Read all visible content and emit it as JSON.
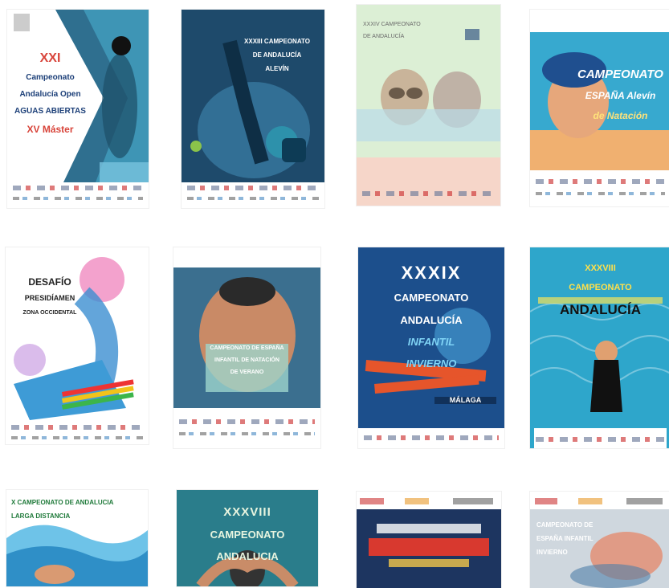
{
  "posters": [
    {
      "id": 1,
      "lines": [
        "XXI",
        "Campeonato",
        "Andalucía Open",
        "AGUAS ABIERTAS",
        "XV Máster"
      ]
    },
    {
      "id": 2,
      "lines": [
        "XXXIII CAMPEONATO",
        "DE ANDALUCÍA",
        "ALEVÍN"
      ]
    },
    {
      "id": 3,
      "lines": [
        "XXXIV CAMPEONATO",
        "DE ANDALUCÍA"
      ]
    },
    {
      "id": 4,
      "lines": [
        "CAMPEONATO",
        "ESPAÑA Alevín",
        "de Natación"
      ]
    },
    {
      "id": 5,
      "lines": [
        "DESAFÍO",
        "PRESIDÍAMEN",
        "ZONA OCCIDENTAL"
      ]
    },
    {
      "id": 6,
      "lines": [
        "CAMPEONATO DE ESPAÑA",
        "INFANTIL DE NATACIÓN",
        "DE VERANO"
      ]
    },
    {
      "id": 7,
      "lines": [
        "XXXIX",
        "CAMPEONATO",
        "ANDALUCÍA",
        "INFANTIL",
        "INVIERNO",
        "MÁLAGA"
      ]
    },
    {
      "id": 8,
      "lines": [
        "XXXVIII",
        "CAMPEONATO",
        "ANDALUCÍA"
      ]
    },
    {
      "id": 9,
      "lines": [
        "X CAMPEONATO DE ANDALUCIA",
        "LARGA DISTANCIA"
      ]
    },
    {
      "id": 10,
      "lines": [
        "XXXVIII",
        "CAMPEONATO",
        "ANDALUCIA"
      ]
    },
    {
      "id": 11,
      "lines": []
    },
    {
      "id": 12,
      "lines": [
        "CAMPEONATO DE",
        "ESPAÑA INFANTIL",
        "INVIERNO"
      ]
    }
  ],
  "colors": {
    "deep_blue": "#1c3f78",
    "teal": "#3aa6b4",
    "light_blue": "#5fc6e8",
    "red": "#d83a3a",
    "yellow": "#f1d34a",
    "pink": "#f2a7c4"
  }
}
